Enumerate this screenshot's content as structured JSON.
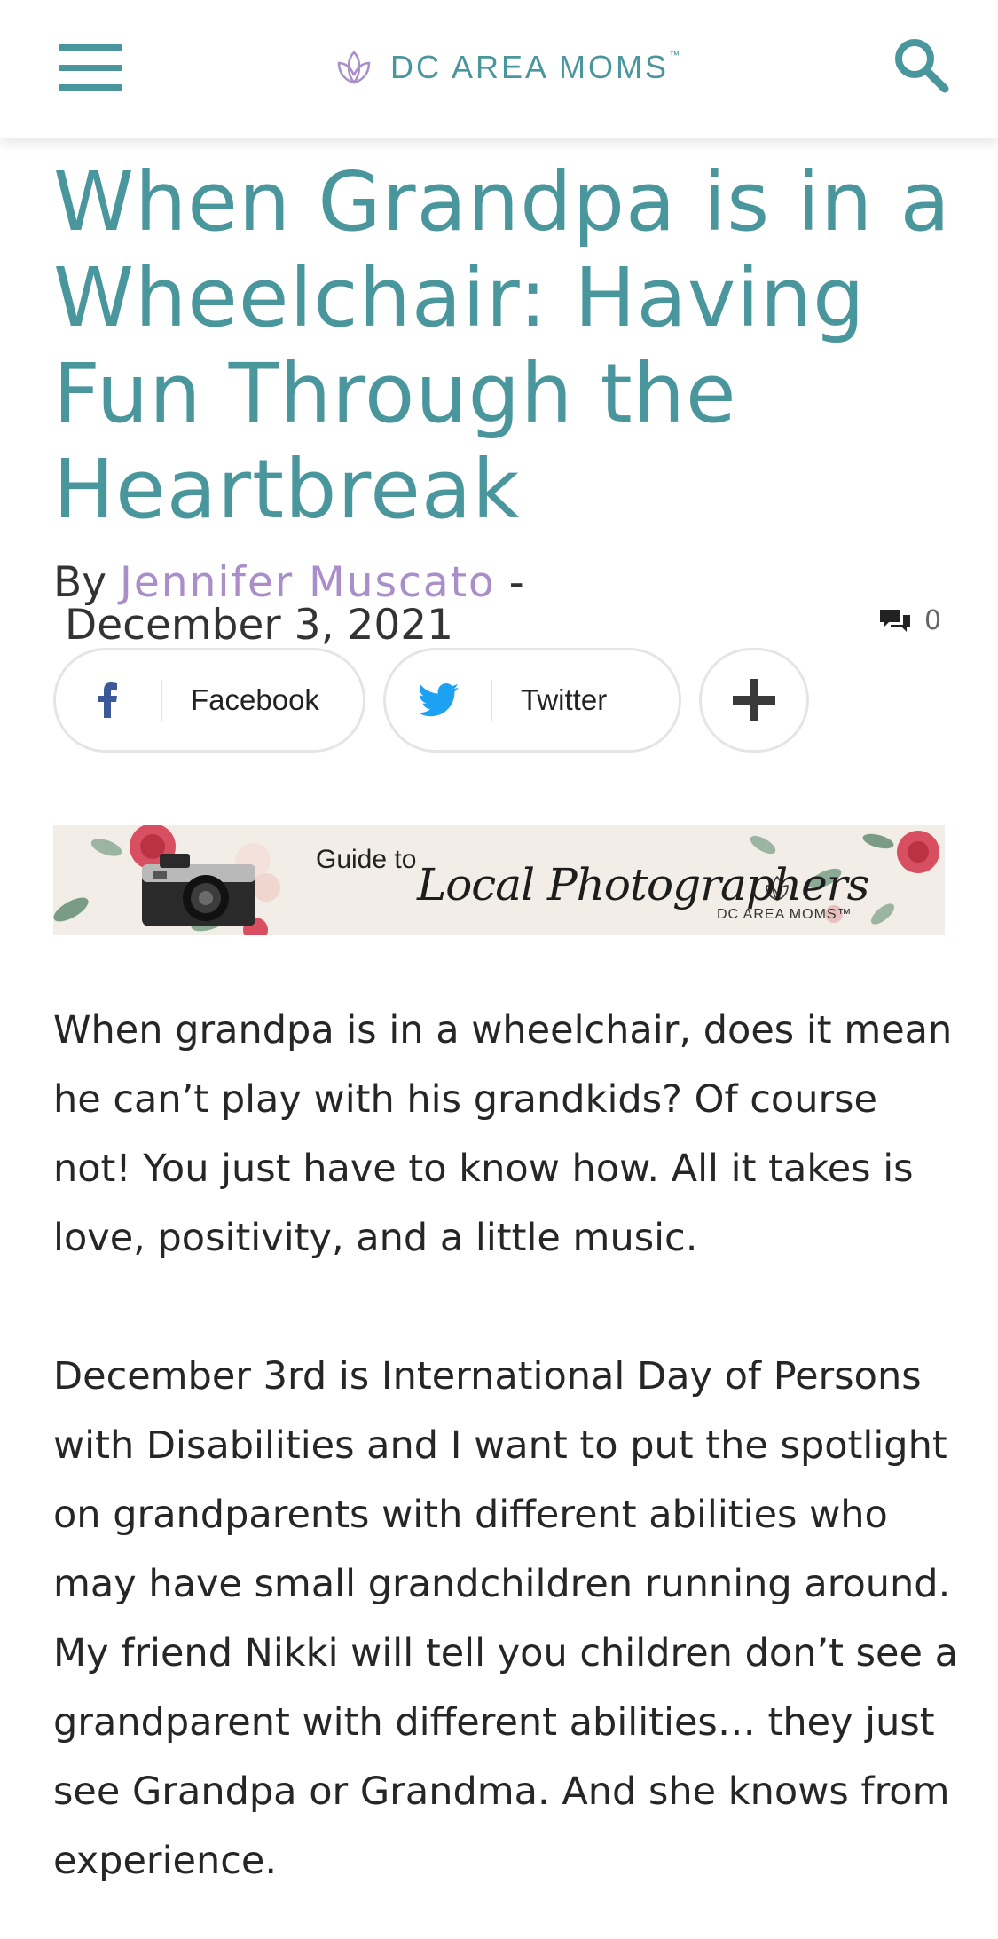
{
  "header": {
    "logo_text": "DC AREA MOMS",
    "logo_tm": "™",
    "accent_color": "#4a969d",
    "icons": [
      "hamburger-menu-icon",
      "lotus-logo-icon",
      "search-icon"
    ]
  },
  "article": {
    "title": "When Grandpa is in a Wheelchair: Having Fun Through the Heartbreak",
    "byline_prefix": "By",
    "author": "Jennifer Muscato",
    "byline_separator": "-",
    "date": "December 3, 2021",
    "comment_count": "0",
    "author_color": "#a98ec9"
  },
  "share": {
    "facebook_label": "Facebook",
    "twitter_label": "Twitter",
    "facebook_color": "#3b5998",
    "twitter_color": "#1da1f2",
    "icons": [
      "facebook-icon",
      "twitter-icon",
      "plus-icon"
    ]
  },
  "banner": {
    "guide_text": "Guide to",
    "script_text": "Local Photographers",
    "brand_text": "DC AREA MOMS™"
  },
  "body": {
    "paragraphs": [
      "When grandpa is in a wheelchair, does it mean he can’t play with his grandkids? Of course not! You just have to know how. All it takes is love, positivity, and a little music.",
      "December 3rd is International Day of Persons with Disabilities and I want to put the spotlight on grandparents with different abilities who may have small grandchildren running around. My friend Nikki will tell you children don’t see a grandparent with different abilities… they just see Grandpa or Grandma. And she knows from experience."
    ]
  }
}
